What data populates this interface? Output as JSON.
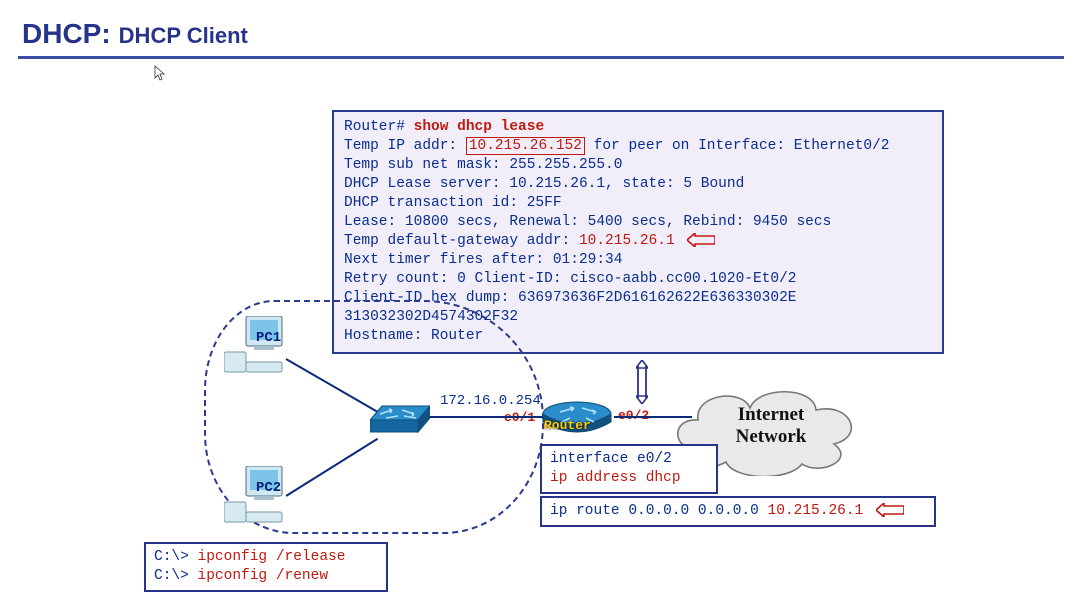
{
  "title": {
    "main": "DHCP:",
    "sub": "DHCP Client"
  },
  "router_output": {
    "prompt": "Router#",
    "cmd": "show dhcp lease",
    "l1a": "Temp IP addr:",
    "ip": "10.215.26.152",
    "l1b": " for peer on Interface: Ethernet0/2",
    "l2": "Temp  sub net mask: 255.255.255.0",
    "l3": "   DHCP Lease server: 10.215.26.1, state: 5 Bound",
    "l4": "   DHCP transaction id: 25FF",
    "l5": "   Lease: 10800 secs,  Renewal: 5400 secs,  Rebind: 9450 secs",
    "l6a": "Temp default-gateway addr: ",
    "gw": "10.215.26.1",
    "l7": "   Next timer fires after: 01:29:34",
    "l8": "   Retry count: 0   Client-ID: cisco-aabb.cc00.1020-Et0/2",
    "l9": "   Client-ID hex dump: 636973636F2D616162622E636330302E",
    "l10": "                       313032302D4574302F32",
    "l11": "   Hostname: Router"
  },
  "labels": {
    "pc1": "PC1",
    "pc2": "PC2",
    "switch_ip": "172.16.0.254",
    "e01": "e0/1",
    "e02": "e0/2",
    "router": "Router",
    "cloud_l1": "Internet",
    "cloud_l2": "Network"
  },
  "int_box": {
    "l1": "interface e0/2",
    "l2": " ip address dhcp"
  },
  "route_box": {
    "text": "ip route  0.0.0.0  0.0.0.0  ",
    "gw": "10.215.26.1"
  },
  "pc_cmd": {
    "p1a": "C:\\>",
    "p1b": " ipconfig /release",
    "p2a": "C:\\>",
    "p2b": " ipconfig /renew"
  }
}
